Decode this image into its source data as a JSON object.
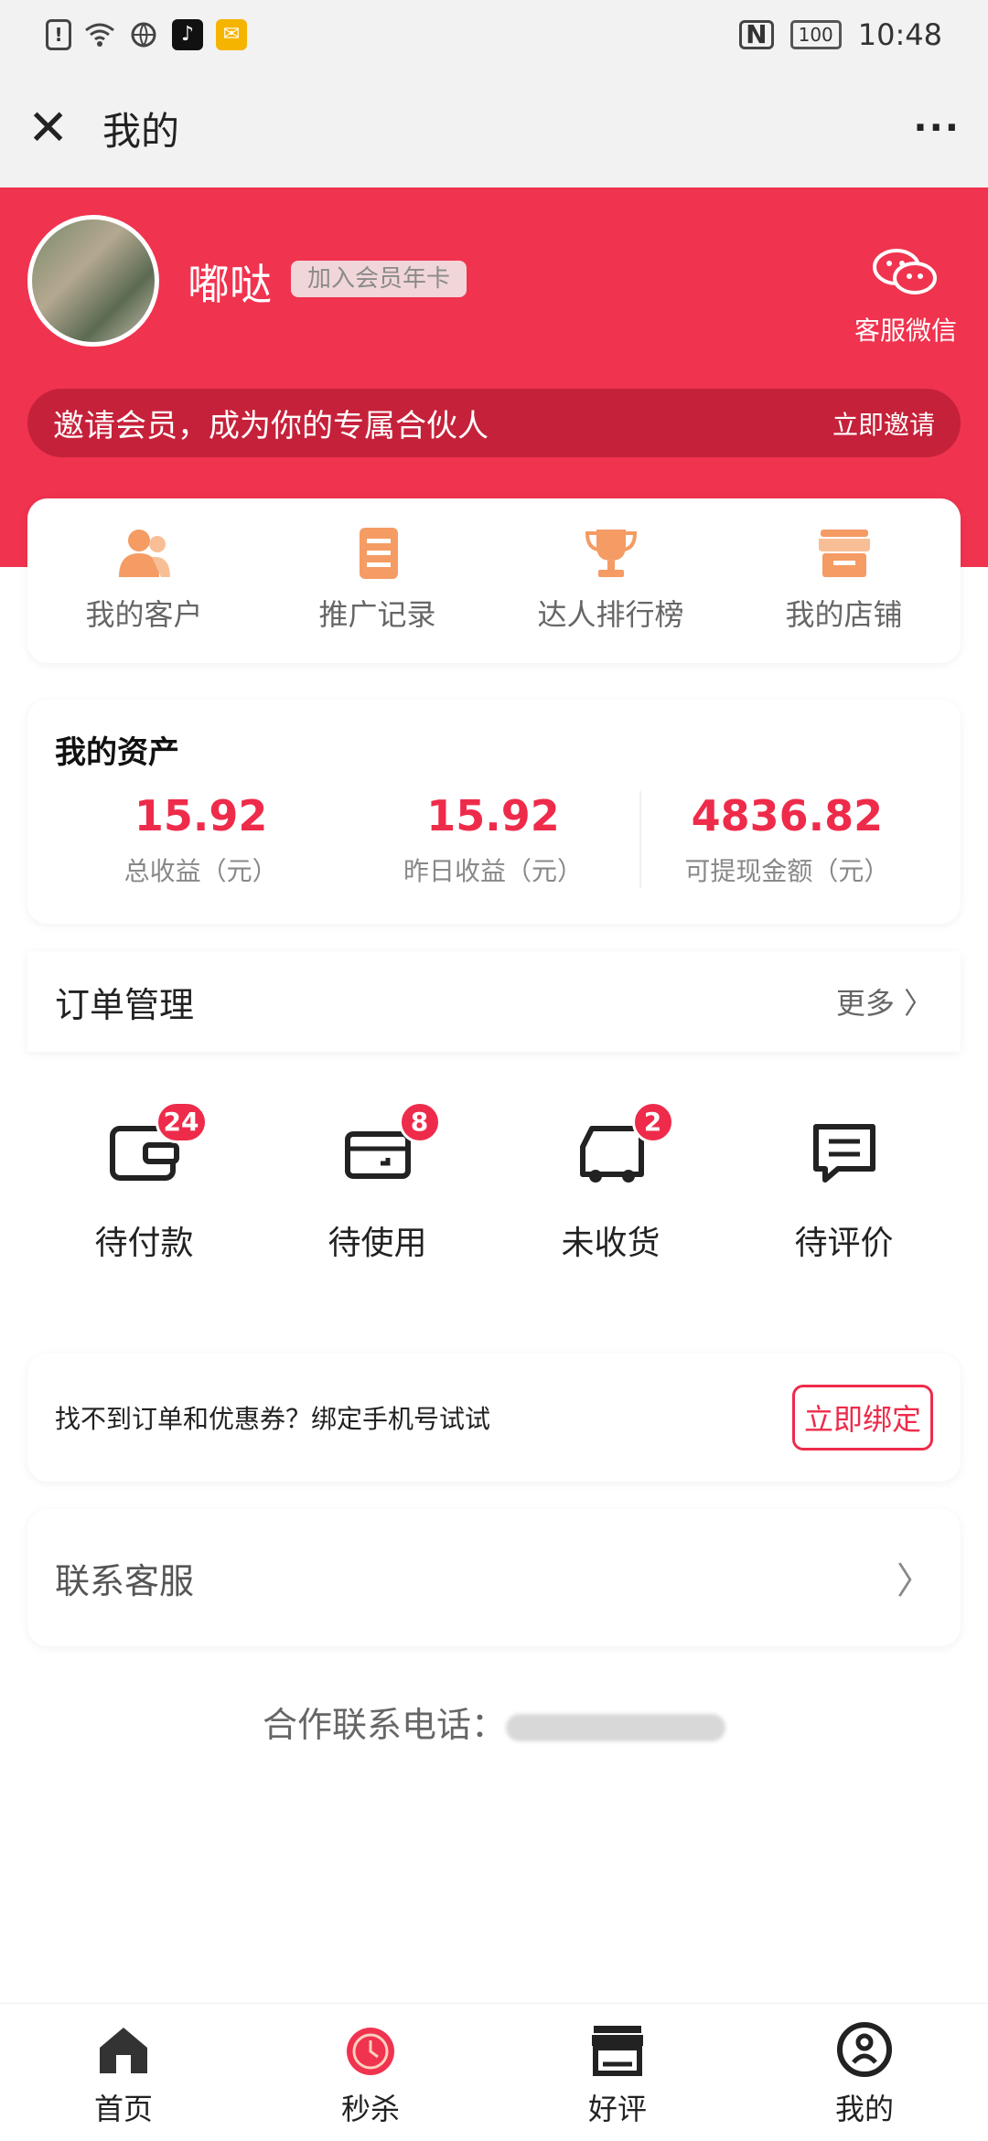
{
  "status": {
    "time": "10:48",
    "battery": "100"
  },
  "nav": {
    "close": "✕",
    "title": "我的",
    "more": "···"
  },
  "profile": {
    "name": "嘟哒",
    "vip_badge": "加入会员年卡",
    "wechat_label": "客服微信",
    "invite_text": "邀请会员，成为你的专属合伙人",
    "invite_button": "立即邀请"
  },
  "quick_links": [
    {
      "label": "我的客户",
      "icon": "customers-icon"
    },
    {
      "label": "推广记录",
      "icon": "records-icon"
    },
    {
      "label": "达人排行榜",
      "icon": "trophy-icon"
    },
    {
      "label": "我的店铺",
      "icon": "shop-icon"
    }
  ],
  "assets": {
    "title": "我的资产",
    "items": [
      {
        "value": "15.92",
        "label": "总收益（元）"
      },
      {
        "value": "15.92",
        "label": "昨日收益（元）"
      },
      {
        "value": "4836.82",
        "label": "可提现金额（元）"
      }
    ]
  },
  "orders": {
    "title": "订单管理",
    "more": "更多 〉",
    "items": [
      {
        "label": "待付款",
        "badge": "24"
      },
      {
        "label": "待使用",
        "badge": "8"
      },
      {
        "label": "未收货",
        "badge": "2"
      },
      {
        "label": "待评价",
        "badge": ""
      }
    ]
  },
  "bind": {
    "hint": "找不到订单和优惠券？绑定手机号试试",
    "button": "立即绑定"
  },
  "service": {
    "label": "联系客服",
    "arrow": "〉"
  },
  "contact": {
    "label": "合作联系电话："
  },
  "tabs": [
    {
      "label": "首页",
      "icon": "home-icon"
    },
    {
      "label": "秒杀",
      "icon": "alarm-clock-icon"
    },
    {
      "label": "好评",
      "icon": "store-icon"
    },
    {
      "label": "我的",
      "icon": "profile-icon"
    }
  ],
  "colors": {
    "brand_red": "#f0334f",
    "accent_red": "#ee2b4a"
  }
}
